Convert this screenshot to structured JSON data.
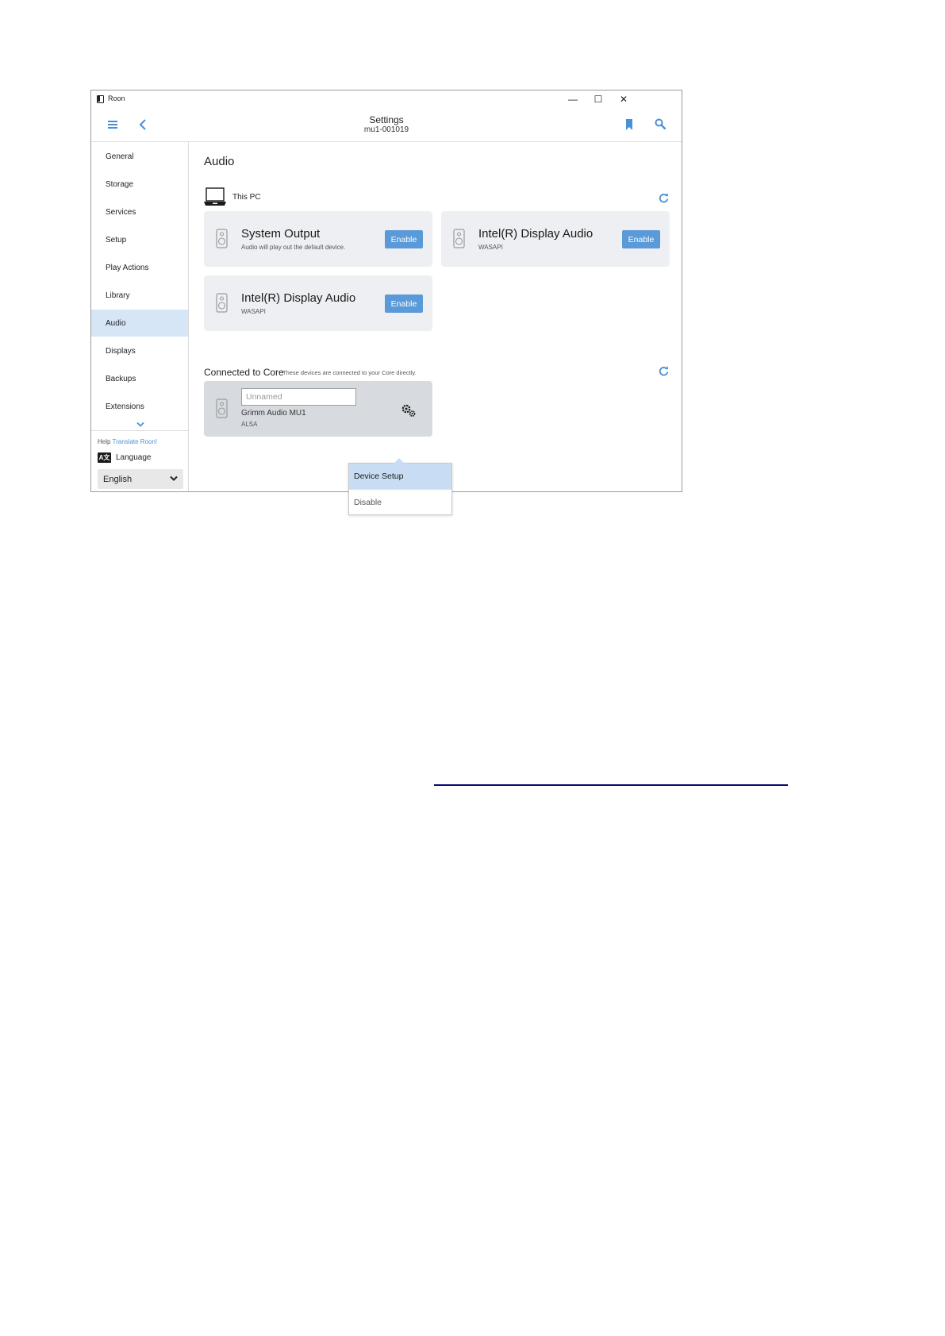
{
  "window": {
    "app_title": "Roon",
    "controls": {
      "minimize": "—",
      "maximize": "☐",
      "close": "✕"
    }
  },
  "header": {
    "title": "Settings",
    "subtitle": "mu1-001019"
  },
  "sidebar": {
    "items": [
      {
        "label": "General"
      },
      {
        "label": "Storage"
      },
      {
        "label": "Services"
      },
      {
        "label": "Setup"
      },
      {
        "label": "Play Actions"
      },
      {
        "label": "Library"
      },
      {
        "label": "Audio",
        "active": true
      },
      {
        "label": "Displays"
      },
      {
        "label": "Backups"
      },
      {
        "label": "Extensions"
      }
    ],
    "help_prefix": "Help",
    "help_link": "Translate Roon!",
    "language_icon": "A文",
    "language_label": "Language",
    "language_value": "English"
  },
  "main": {
    "title": "Audio",
    "this_pc": {
      "label": "This PC",
      "devices": [
        {
          "name": "System Output",
          "description": "Audio will play out the default device.",
          "button": "Enable"
        },
        {
          "name": "Intel(R) Display Audio",
          "description": "WASAPI",
          "button": "Enable"
        },
        {
          "name": "Intel(R) Display Audio",
          "description": "WASAPI",
          "button": "Enable"
        }
      ]
    },
    "connected": {
      "title": "Connected to Core",
      "note": "These devices are connected to your Core directly.",
      "device": {
        "name_placeholder": "Unnamed",
        "model": "Grimm Audio MU1",
        "driver": "ALSA"
      }
    },
    "dropdown": {
      "items": [
        "Device Setup",
        "Disable"
      ]
    }
  },
  "colors": {
    "accent": "#4a90d9",
    "button": "#5a9ad8",
    "active_nav": "#d6e6f7",
    "card": "#edeff2",
    "card_selected": "#d7dbe0"
  }
}
